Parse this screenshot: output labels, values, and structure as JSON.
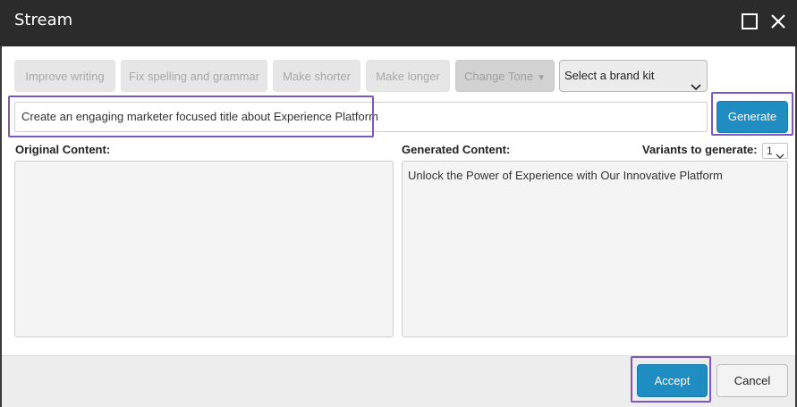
{
  "window": {
    "title": "Stream",
    "maximize_icon": "maximize-icon",
    "close_icon": "close-icon"
  },
  "toolbar": {
    "improve_writing": "Improve writing",
    "fix_spelling": "Fix spelling and grammar",
    "make_shorter": "Make shorter",
    "make_longer": "Make longer",
    "change_tone": "Change Tone",
    "change_tone_caret": "▼",
    "brand_kit_selected": "Select a brand kit"
  },
  "prompt": {
    "value": "Create an engaging marketer focused title about Experience Platform"
  },
  "generate_label": "Generate",
  "original": {
    "label": "Original Content:",
    "value": ""
  },
  "generated": {
    "label": "Generated Content:",
    "value": "Unlock the Power of Experience with Our Innovative Platform"
  },
  "variants": {
    "label": "Variants to generate:",
    "selected": "1"
  },
  "footer": {
    "accept_label": "Accept",
    "cancel_label": "Cancel"
  },
  "colors": {
    "titlebar": "#2b2b2b",
    "primary": "#1f8cc2",
    "highlight": "#7d57c1"
  }
}
